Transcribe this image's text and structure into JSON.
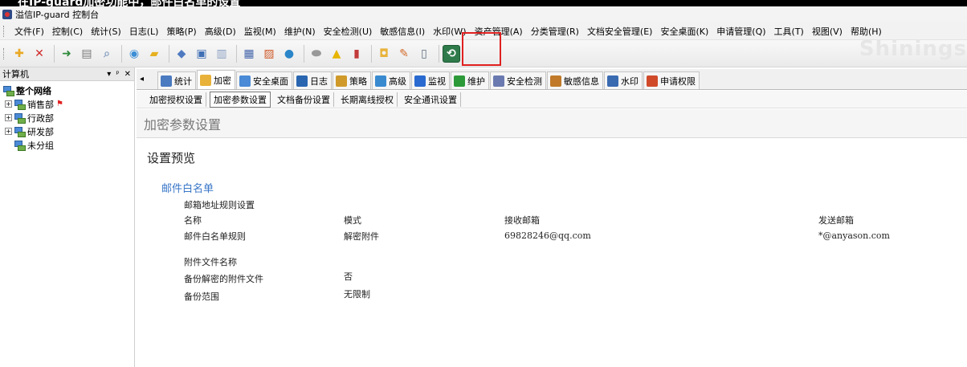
{
  "caption": {
    "text": "在IP-guard加密功能中，邮件白名单的设置"
  },
  "titlebar": {
    "title": "溢信IP-guard 控制台"
  },
  "menubar": {
    "items": [
      "文件(F)",
      "控制(C)",
      "统计(S)",
      "日志(L)",
      "策略(P)",
      "高级(D)",
      "监视(M)",
      "维护(N)",
      "安全检测(U)",
      "敏感信息(I)",
      "水印(W)",
      "资产管理(A)",
      "分类管理(R)",
      "文档安全管理(E)",
      "安全桌面(K)",
      "申请管理(Q)",
      "工具(T)",
      "视图(V)",
      "帮助(H)"
    ]
  },
  "toolbar": {
    "brand_watermark": "Shinings",
    "buttons": [
      {
        "icon": "add-icon",
        "color": "#e9a825"
      },
      {
        "icon": "delete-icon",
        "color": "#d02a2a"
      },
      {
        "icon": "import-icon",
        "color": "#2d8a3a"
      },
      {
        "icon": "print-icon",
        "color": "#7a7a7a"
      },
      {
        "icon": "print-preview-icon",
        "color": "#8aa0c0"
      },
      {
        "icon": "network-globe-icon",
        "color": "#3c8ed6"
      },
      {
        "icon": "folder-icon",
        "color": "#e6b020"
      },
      {
        "icon": "cube-icon",
        "color": "#4f7ac0"
      },
      {
        "icon": "monitor-icon",
        "color": "#3f6fb5"
      },
      {
        "icon": "document-icon",
        "color": "#8a9fc2"
      },
      {
        "icon": "computer-icon",
        "color": "#4466aa"
      },
      {
        "icon": "chart-icon",
        "color": "#d05a2a"
      },
      {
        "icon": "earth-icon",
        "color": "#2a86c8"
      },
      {
        "icon": "disk-icon",
        "color": "#999999"
      },
      {
        "icon": "warning-icon",
        "color": "#e7b400"
      },
      {
        "icon": "book-icon",
        "color": "#c23a3a"
      },
      {
        "icon": "lock-icon",
        "color": "#e8b23a"
      },
      {
        "icon": "edit-icon",
        "color": "#d36a2a"
      },
      {
        "icon": "usb-icon",
        "color": "#5a6a7a"
      },
      {
        "icon": "encrypt-settings-icon",
        "color": "#3a9a5a"
      }
    ]
  },
  "left_panel": {
    "title": "计算机",
    "controls": [
      "▾",
      "ᵖ",
      "✕"
    ],
    "tree": [
      {
        "label": "整个网络",
        "level": 0,
        "bold": true,
        "expander": ""
      },
      {
        "label": "销售部",
        "level": 1,
        "bold": false,
        "expander": "+",
        "flag": true
      },
      {
        "label": "行政部",
        "level": 1,
        "bold": false,
        "expander": "+"
      },
      {
        "label": "研发部",
        "level": 1,
        "bold": false,
        "expander": "+"
      },
      {
        "label": "未分组",
        "level": 1,
        "bold": false,
        "expander": ""
      }
    ]
  },
  "tabs": {
    "scroll_left": "◂",
    "items": [
      {
        "label": "统计",
        "color": "#4a7ac0",
        "active": false
      },
      {
        "label": "加密",
        "color": "#e8b23a",
        "active": true
      },
      {
        "label": "安全桌面",
        "color": "#4a8ad6",
        "active": false
      },
      {
        "label": "日志",
        "color": "#2a66b0",
        "active": false
      },
      {
        "label": "策略",
        "color": "#d09a2a",
        "active": false
      },
      {
        "label": "高级",
        "color": "#3a8ad0",
        "active": false
      },
      {
        "label": "监视",
        "color": "#2a6ad0",
        "active": false
      },
      {
        "label": "维护",
        "color": "#2d9a3a",
        "active": false
      },
      {
        "label": "安全检测",
        "color": "#6a7ab0",
        "active": false
      },
      {
        "label": "敏感信息",
        "color": "#c07a2a",
        "active": false
      },
      {
        "label": "水印",
        "color": "#3a6ab0",
        "active": false
      },
      {
        "label": "申请权限",
        "color": "#d04a2a",
        "active": false
      }
    ]
  },
  "subtabs": {
    "items": [
      {
        "label": "加密授权设置",
        "active": false
      },
      {
        "label": "加密参数设置",
        "active": true
      },
      {
        "label": "文档备份设置",
        "active": false
      },
      {
        "label": "长期离线授权",
        "active": false
      },
      {
        "label": "安全通讯设置",
        "active": false
      }
    ]
  },
  "content": {
    "page_title": "加密参数设置",
    "section_title": "设置预览",
    "group_title": "邮件白名单",
    "rules_title": "邮箱地址规则设置",
    "columns": {
      "name": "名称",
      "mode": "模式",
      "receive": "接收邮箱",
      "send": "发送邮箱"
    },
    "row": {
      "name": "邮件白名单规则",
      "mode": "解密附件",
      "receive": "69828246@qq.com",
      "send": "*@anyason.com"
    },
    "attachment_name_label": "附件文件名称",
    "backup_label": "备份解密的附件文件",
    "backup_value": "否",
    "scope_label": "备份范围",
    "scope_value": "无限制"
  }
}
